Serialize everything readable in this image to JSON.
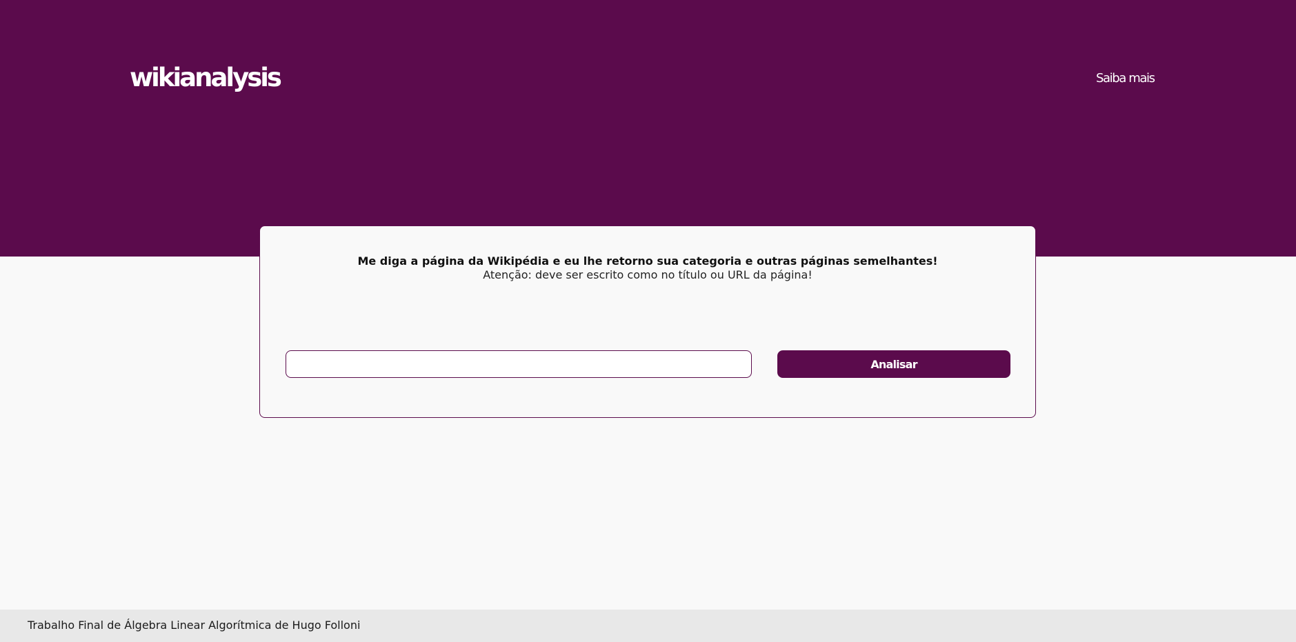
{
  "header": {
    "logo": "wikianalysis",
    "nav_link": "Saiba mais"
  },
  "card": {
    "heading": "Me diga a página da Wikipédia e eu lhe retorno sua categoria e outras páginas semelhantes!",
    "subtitle": "Atenção: deve ser escrito como no título ou URL da página!",
    "input_value": "",
    "button_label": "Analisar"
  },
  "footer": {
    "text": "Trabalho Final de Álgebra Linear Algorítmica de Hugo Folloni"
  },
  "colors": {
    "brand": "#5b0b4c",
    "background": "#f9f9f9",
    "footer_background": "#e8e8e8"
  }
}
